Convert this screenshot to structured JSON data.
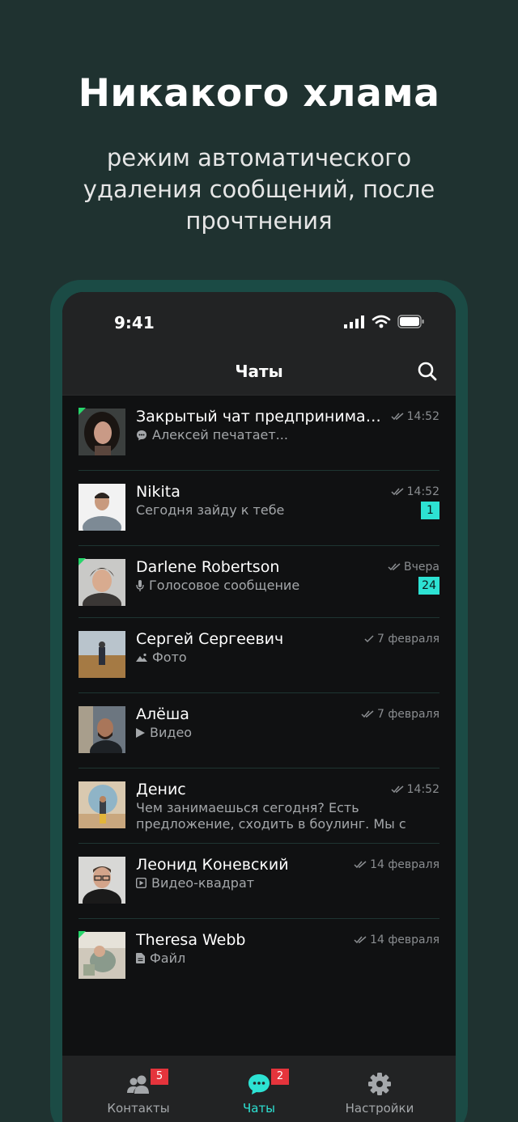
{
  "hero": {
    "title": "Никакого хлама",
    "subtitle": "режим автоматического удаления сообщений, после прочтнения"
  },
  "status_bar": {
    "time": "9:41"
  },
  "nav": {
    "title": "Чаты",
    "search_icon": "search-icon"
  },
  "chats": [
    {
      "name": "Закрытый чат  предпринимател...",
      "time": "14:52",
      "preview": "Алексей печатает...",
      "preview_icon": "typing-icon",
      "online": true
    },
    {
      "name": "Nikita",
      "time": "14:52",
      "preview": "Сегодня зайду к тебе",
      "unread": "1",
      "online": false
    },
    {
      "name": "Darlene Robertson",
      "time": "Вчера",
      "preview": "Голосовое сообщение",
      "preview_icon": "microphone-icon",
      "unread": "24",
      "online": true
    },
    {
      "name": "Сергей Сергеевич",
      "time": "7 февраля",
      "preview": "Фото",
      "preview_icon": "photo-icon",
      "online": false
    },
    {
      "name": "Алёша",
      "time": "7 февраля",
      "preview": "Видео",
      "preview_icon": "play-icon",
      "online": false
    },
    {
      "name": "Денис",
      "time": "14:52",
      "preview": "Чем занимаешься сегодня? Есть предложение, сходить в боулинг. Мы с Леон...",
      "online": false
    },
    {
      "name": "Леонид Коневский",
      "time": "14 февраля",
      "preview": "Видео-квадрат",
      "preview_icon": "video-square-icon",
      "online": false
    },
    {
      "name": "Theresa Webb",
      "time": "14 февраля",
      "preview": "Файл",
      "preview_icon": "file-icon",
      "online": true
    }
  ],
  "tabs": [
    {
      "label": "Контакты",
      "badge": "5",
      "icon": "contacts-icon"
    },
    {
      "label": "Чаты",
      "badge": "2",
      "icon": "chat-bubble-icon",
      "active": true
    },
    {
      "label": "Настройки",
      "icon": "gear-icon"
    }
  ],
  "colors": {
    "background": "#1f3230",
    "frame": "#1b4b45",
    "accent": "#2de2d3",
    "badge": "#e5343c",
    "online": "#27d56b"
  }
}
